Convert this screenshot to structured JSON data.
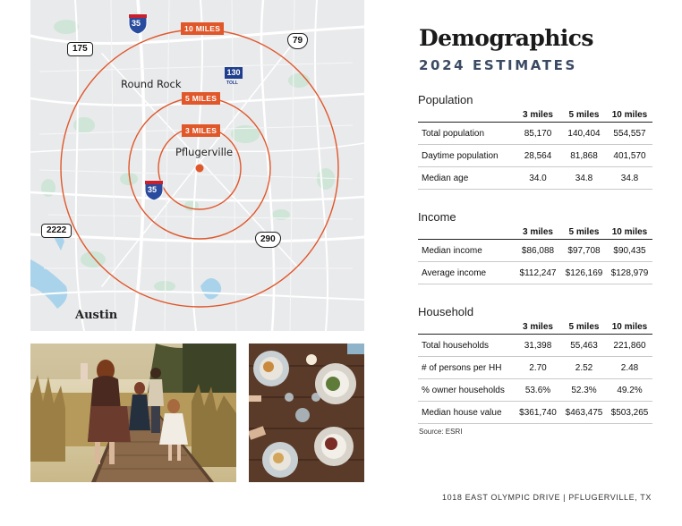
{
  "map": {
    "ring_labels": [
      "10 MILES",
      "5 MILES",
      "3 MILES"
    ],
    "places": {
      "round_rock": "Round Rock",
      "pflugerville": "Pflugerville",
      "austin": "Austin"
    },
    "shields": {
      "i35_top": "35",
      "i35_mid": "35",
      "tx175": "175",
      "us79": "79",
      "sh130": "130",
      "toll": "TOLL",
      "fm2222": "2222",
      "us290": "290"
    },
    "colors": {
      "ring": "#e0572a",
      "background": "#e9eaec"
    }
  },
  "title": "Demographics",
  "subtitle": "2024 ESTIMATES",
  "columns": [
    "3 miles",
    "5 miles",
    "10 miles"
  ],
  "population": {
    "heading": "Population",
    "rows": [
      {
        "label": "Total population",
        "v": [
          "85,170",
          "140,404",
          "554,557"
        ]
      },
      {
        "label": "Daytime population",
        "v": [
          "28,564",
          "81,868",
          "401,570"
        ]
      },
      {
        "label": "Median age",
        "v": [
          "34.0",
          "34.8",
          "34.8"
        ]
      }
    ]
  },
  "income": {
    "heading": "Income",
    "rows": [
      {
        "label": "Median income",
        "v": [
          "$86,088",
          "$97,708",
          "$90,435"
        ]
      },
      {
        "label": "Average income",
        "v": [
          "$112,247",
          "$126,169",
          "$128,979"
        ]
      }
    ]
  },
  "household": {
    "heading": "Household",
    "rows": [
      {
        "label": "Total households",
        "v": [
          "31,398",
          "55,463",
          "221,860"
        ]
      },
      {
        "label": "# of persons per HH",
        "v": [
          "2.70",
          "2.52",
          "2.48"
        ]
      },
      {
        "label": "% owner households",
        "v": [
          "53.6%",
          "52.3%",
          "49.2%"
        ]
      },
      {
        "label": "Median house value",
        "v": [
          "$361,740",
          "$463,475",
          "$503,265"
        ]
      }
    ]
  },
  "source": "Source: ESRI",
  "address": "1018 EAST OLYMPIC DRIVE  |  PFLUGERVILLE, TX"
}
